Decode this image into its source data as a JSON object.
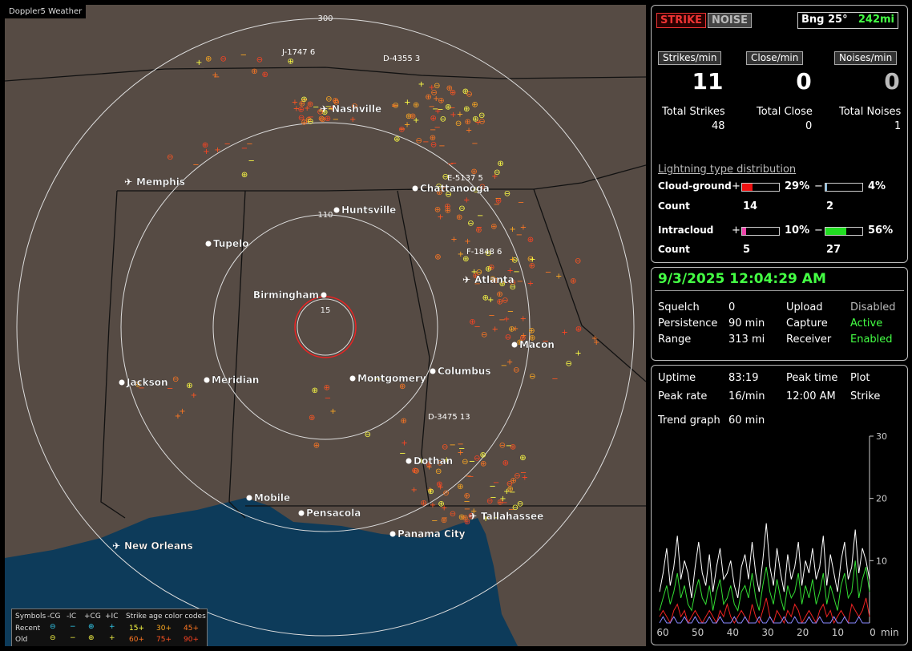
{
  "app_title": "Doppler5 Weather",
  "map": {
    "rings": [
      {
        "label": "300"
      },
      {
        "label": "110"
      },
      {
        "label": "15"
      }
    ],
    "cities": [
      {
        "name": "Nashville",
        "airport": true
      },
      {
        "name": "Memphis",
        "airport": true
      },
      {
        "name": "Chattanooga",
        "airport": false
      },
      {
        "name": "Huntsville",
        "airport": false
      },
      {
        "name": "Tupelo",
        "airport": false
      },
      {
        "name": "Birmingham",
        "airport": false
      },
      {
        "name": "Atlanta",
        "airport": true
      },
      {
        "name": "Macon",
        "airport": false
      },
      {
        "name": "Jackson",
        "airport": false
      },
      {
        "name": "Meridian",
        "airport": false
      },
      {
        "name": "Montgomery",
        "airport": false
      },
      {
        "name": "Columbus",
        "airport": false
      },
      {
        "name": "Dothan",
        "airport": false
      },
      {
        "name": "Mobile",
        "airport": false
      },
      {
        "name": "Pensacola",
        "airport": false
      },
      {
        "name": "Tallahassee",
        "airport": true
      },
      {
        "name": "Panama City",
        "airport": false
      },
      {
        "name": "New Orleans",
        "airport": true
      }
    ],
    "storm_tags": [
      "J-1747",
      "D-4355",
      "E-5137",
      "F-1848",
      "D-3475"
    ],
    "storm_tag_suffix": [
      "6",
      "3",
      "5",
      "6",
      "13"
    ]
  },
  "legend": {
    "symbols_label": "Symbols",
    "headers": [
      "-CG",
      "-IC",
      "+CG",
      "+IC"
    ],
    "age_title": "Strike age color codes",
    "recent_label": "Recent",
    "old_label": "Old",
    "recent_ages": [
      "15+",
      "30+",
      "45+"
    ],
    "old_ages": [
      "60+",
      "75+",
      "90+"
    ],
    "age_colors": [
      "#ffff44",
      "#ffaa22",
      "#ff7722",
      "#ff7722",
      "#ff5522",
      "#ff4422"
    ]
  },
  "top_panel": {
    "strike_btn": "STRIKE",
    "noise_btn": "NOISE",
    "bearing": "Bng 25°",
    "distance": "242mi",
    "strikes_min_label": "Strikes/min",
    "close_min_label": "Close/min",
    "noises_min_label": "Noises/min",
    "strikes_min": "11",
    "close_min": "0",
    "noises_min": "0",
    "total_strikes_label": "Total Strikes",
    "total_close_label": "Total Close",
    "total_noises_label": "Total Noises",
    "total_strikes": "48",
    "total_close": "0",
    "total_noises": "1",
    "dist_title": "Lightning type distribution",
    "cg_label": "Cloud-ground",
    "ic_label": "Intracloud",
    "count_label": "Count",
    "plus": "+",
    "minus": "−",
    "cg_plus_pct": "29%",
    "cg_minus_pct": "4%",
    "ic_plus_pct": "10%",
    "ic_minus_pct": "56%",
    "cg_plus_frac": 0.29,
    "cg_minus_frac": 0.04,
    "ic_plus_frac": 0.1,
    "ic_minus_frac": 0.56,
    "cg_plus_count": "14",
    "cg_minus_count": "2",
    "ic_plus_count": "5",
    "ic_minus_count": "27"
  },
  "status_panel": {
    "datetime": "9/3/2025 12:04:29 AM",
    "squelch_label": "Squelch",
    "squelch": "0",
    "persistence_label": "Persistence",
    "persistence": "90 min",
    "range_label": "Range",
    "range": "313 mi",
    "upload_label": "Upload",
    "upload": "Disabled",
    "capture_label": "Capture",
    "capture": "Active",
    "receiver_label": "Receiver",
    "receiver": "Enabled"
  },
  "trend_panel": {
    "uptime_label": "Uptime",
    "uptime": "83:19",
    "peak_time_label": "Peak time",
    "plot_label": "Plot",
    "peak_rate_label": "Peak rate",
    "peak_rate": "16/min",
    "peak_time": "12:00 AM",
    "plot": "Strike",
    "trend_label": "Trend graph",
    "trend_value": "60 min"
  },
  "chart_data": {
    "type": "line",
    "x_ticks": [
      "60",
      "50",
      "40",
      "30",
      "20",
      "10",
      "0"
    ],
    "x_unit": "min",
    "y_ticks": [
      "30",
      "20",
      "10"
    ],
    "ylim": [
      0,
      30
    ],
    "series_colors": [
      "#ffffff",
      "#33dd33",
      "#ee2222",
      "#8888ff"
    ],
    "series": [
      {
        "values": [
          5,
          8,
          12,
          6,
          9,
          14,
          7,
          10,
          8,
          4,
          9,
          13,
          8,
          6,
          11,
          5,
          9,
          12,
          7,
          8,
          10,
          6,
          4,
          9,
          11,
          7,
          13,
          8,
          5,
          10,
          16,
          9,
          6,
          12,
          8,
          5,
          11,
          7,
          9,
          13,
          6,
          10,
          8,
          12,
          7,
          9,
          14,
          6,
          11,
          8,
          5,
          10,
          13,
          7,
          9,
          15,
          8,
          12,
          10,
          7
        ]
      },
      {
        "values": [
          2,
          4,
          6,
          3,
          5,
          8,
          4,
          6,
          3,
          2,
          5,
          7,
          4,
          3,
          6,
          2,
          5,
          7,
          3,
          4,
          6,
          3,
          2,
          5,
          6,
          4,
          8,
          4,
          2,
          6,
          9,
          5,
          3,
          7,
          4,
          2,
          6,
          4,
          5,
          8,
          3,
          6,
          4,
          7,
          3,
          5,
          8,
          3,
          6,
          4,
          2,
          6,
          8,
          4,
          5,
          10,
          4,
          7,
          9,
          5
        ]
      },
      {
        "values": [
          1,
          2,
          1,
          0,
          2,
          3,
          1,
          2,
          0,
          1,
          2,
          1,
          0,
          1,
          2,
          1,
          0,
          2,
          1,
          3,
          1,
          0,
          1,
          2,
          1,
          0,
          3,
          1,
          0,
          2,
          4,
          1,
          0,
          2,
          1,
          0,
          2,
          1,
          3,
          2,
          0,
          1,
          2,
          1,
          0,
          2,
          3,
          1,
          2,
          0,
          1,
          2,
          1,
          0,
          3,
          2,
          1,
          2,
          4,
          1
        ]
      },
      {
        "values": [
          0,
          1,
          0,
          0,
          1,
          0,
          0,
          1,
          0,
          0,
          1,
          0,
          0,
          0,
          1,
          0,
          0,
          1,
          0,
          0,
          0,
          1,
          0,
          0,
          1,
          0,
          0,
          0,
          1,
          0,
          0,
          1,
          0,
          0,
          0,
          1,
          0,
          0,
          1,
          0,
          0,
          0,
          1,
          0,
          0,
          1,
          0,
          0,
          0,
          1,
          0,
          0,
          1,
          0,
          0,
          0,
          1,
          0,
          0,
          0
        ]
      }
    ]
  }
}
